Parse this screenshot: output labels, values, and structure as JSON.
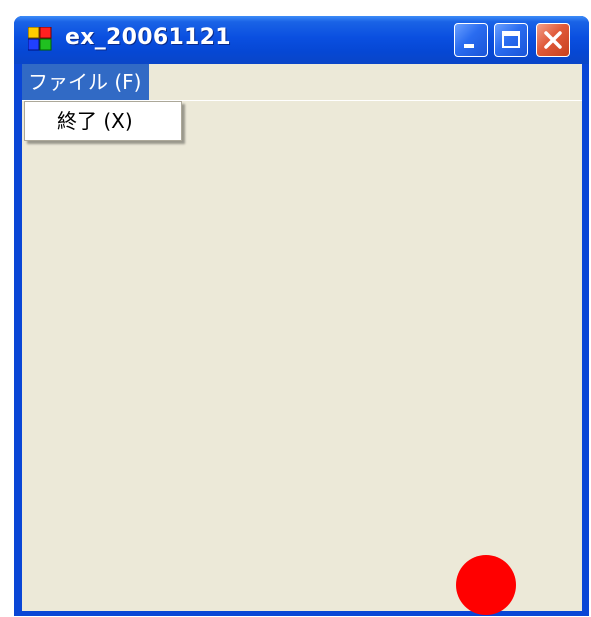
{
  "window": {
    "title": "ex_20061121",
    "controls": {
      "minimize": "minimize",
      "maximize": "maximize",
      "close": "close"
    }
  },
  "menubar": {
    "items": [
      {
        "label": "ファイル (F)",
        "open": true
      }
    ]
  },
  "file_menu": {
    "items": [
      {
        "label": "終了 (X)"
      }
    ]
  },
  "canvas": {
    "ball": {
      "color": "#ff0000",
      "shape": "circle"
    },
    "background_color": "#ece9d8"
  },
  "colors": {
    "titlebar": "#0a4fe0",
    "menu_highlight": "#316ac5",
    "close_button": "#e05a3a"
  }
}
